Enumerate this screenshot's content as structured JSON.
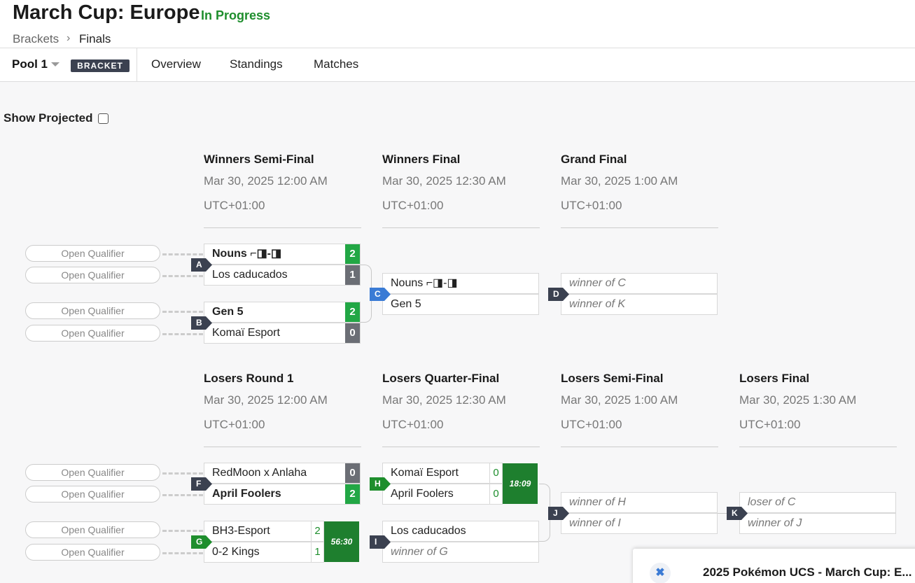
{
  "header": {
    "title": "March Cup: Europe",
    "status": "In Progress",
    "status_color": "#1e8e2d",
    "breadcrumb": [
      "Brackets",
      "Finals"
    ]
  },
  "toolbar": {
    "pool_label": "Pool 1",
    "bracket_badge": "BRACKET",
    "tabs": [
      "Overview",
      "Standings",
      "Matches"
    ]
  },
  "show_projected": {
    "label": "Show Projected",
    "checked": false
  },
  "qualifier_label": "Open Qualifier",
  "rounds": {
    "winners_semi": {
      "title": "Winners Semi-Final",
      "date": "Mar 30, 2025 12:00 AM",
      "tz": "UTC+01:00"
    },
    "winners_final": {
      "title": "Winners Final",
      "date": "Mar 30, 2025 12:30 AM",
      "tz": "UTC+01:00"
    },
    "grand_final": {
      "title": "Grand Final",
      "date": "Mar 30, 2025 1:00 AM",
      "tz": "UTC+01:00"
    },
    "losers_r1": {
      "title": "Losers Round 1",
      "date": "Mar 30, 2025 12:00 AM",
      "tz": "UTC+01:00"
    },
    "losers_qf": {
      "title": "Losers Quarter-Final",
      "date": "Mar 30, 2025 12:30 AM",
      "tz": "UTC+01:00"
    },
    "losers_sf": {
      "title": "Losers Semi-Final",
      "date": "Mar 30, 2025 1:00 AM",
      "tz": "UTC+01:00"
    },
    "losers_final": {
      "title": "Losers Final",
      "date": "Mar 30, 2025 1:30 AM",
      "tz": "UTC+01:00"
    }
  },
  "matches": {
    "A": {
      "label": "A",
      "top": {
        "name": "Nouns ⌐◨-◨",
        "score": "2"
      },
      "bottom": {
        "name": "Los caducados",
        "score": "1"
      }
    },
    "B": {
      "label": "B",
      "top": {
        "name": "Gen 5",
        "score": "2"
      },
      "bottom": {
        "name": "Komaï Esport",
        "score": "0"
      }
    },
    "C": {
      "label": "C",
      "top": {
        "name": "Nouns ⌐◨-◨"
      },
      "bottom": {
        "name": "Gen 5"
      }
    },
    "D": {
      "label": "D",
      "top": {
        "name": "winner of C"
      },
      "bottom": {
        "name": "winner of K"
      }
    },
    "F": {
      "label": "F",
      "top": {
        "name": "RedMoon x Anlaha",
        "score": "0"
      },
      "bottom": {
        "name": "April Foolers",
        "score": "2"
      }
    },
    "G": {
      "label": "G",
      "top": {
        "name": "BH3-Esport",
        "score": "2"
      },
      "bottom": {
        "name": "0-2 Kings",
        "score": "1"
      },
      "timer": "56:30"
    },
    "H": {
      "label": "H",
      "top": {
        "name": "Komaï Esport",
        "score": "0"
      },
      "bottom": {
        "name": "April Foolers",
        "score": "0"
      },
      "timer": "18:09"
    },
    "I": {
      "label": "I",
      "top": {
        "name": "Los caducados"
      },
      "bottom": {
        "name": "winner of G"
      }
    },
    "J": {
      "label": "J",
      "top": {
        "name": "winner of H"
      },
      "bottom": {
        "name": "winner of I"
      }
    },
    "K": {
      "label": "K",
      "top": {
        "name": "loser of C"
      },
      "bottom": {
        "name": "winner of J"
      }
    }
  },
  "toast": {
    "text": "2025 Pokémon UCS - March Cup: E...",
    "close_icon": "close-icon"
  }
}
